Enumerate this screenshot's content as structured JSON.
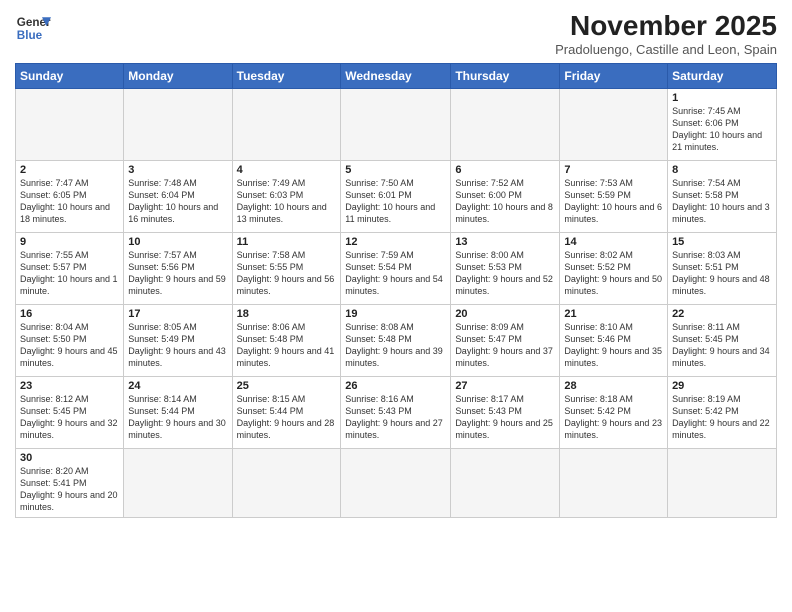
{
  "header": {
    "logo_line1": "General",
    "logo_line2": "Blue",
    "month": "November 2025",
    "location": "Pradoluengo, Castille and Leon, Spain"
  },
  "weekdays": [
    "Sunday",
    "Monday",
    "Tuesday",
    "Wednesday",
    "Thursday",
    "Friday",
    "Saturday"
  ],
  "weeks": [
    [
      {
        "day": "",
        "info": ""
      },
      {
        "day": "",
        "info": ""
      },
      {
        "day": "",
        "info": ""
      },
      {
        "day": "",
        "info": ""
      },
      {
        "day": "",
        "info": ""
      },
      {
        "day": "",
        "info": ""
      },
      {
        "day": "1",
        "info": "Sunrise: 7:45 AM\nSunset: 6:06 PM\nDaylight: 10 hours and 21 minutes."
      }
    ],
    [
      {
        "day": "2",
        "info": "Sunrise: 7:47 AM\nSunset: 6:05 PM\nDaylight: 10 hours and 18 minutes."
      },
      {
        "day": "3",
        "info": "Sunrise: 7:48 AM\nSunset: 6:04 PM\nDaylight: 10 hours and 16 minutes."
      },
      {
        "day": "4",
        "info": "Sunrise: 7:49 AM\nSunset: 6:03 PM\nDaylight: 10 hours and 13 minutes."
      },
      {
        "day": "5",
        "info": "Sunrise: 7:50 AM\nSunset: 6:01 PM\nDaylight: 10 hours and 11 minutes."
      },
      {
        "day": "6",
        "info": "Sunrise: 7:52 AM\nSunset: 6:00 PM\nDaylight: 10 hours and 8 minutes."
      },
      {
        "day": "7",
        "info": "Sunrise: 7:53 AM\nSunset: 5:59 PM\nDaylight: 10 hours and 6 minutes."
      },
      {
        "day": "8",
        "info": "Sunrise: 7:54 AM\nSunset: 5:58 PM\nDaylight: 10 hours and 3 minutes."
      }
    ],
    [
      {
        "day": "9",
        "info": "Sunrise: 7:55 AM\nSunset: 5:57 PM\nDaylight: 10 hours and 1 minute."
      },
      {
        "day": "10",
        "info": "Sunrise: 7:57 AM\nSunset: 5:56 PM\nDaylight: 9 hours and 59 minutes."
      },
      {
        "day": "11",
        "info": "Sunrise: 7:58 AM\nSunset: 5:55 PM\nDaylight: 9 hours and 56 minutes."
      },
      {
        "day": "12",
        "info": "Sunrise: 7:59 AM\nSunset: 5:54 PM\nDaylight: 9 hours and 54 minutes."
      },
      {
        "day": "13",
        "info": "Sunrise: 8:00 AM\nSunset: 5:53 PM\nDaylight: 9 hours and 52 minutes."
      },
      {
        "day": "14",
        "info": "Sunrise: 8:02 AM\nSunset: 5:52 PM\nDaylight: 9 hours and 50 minutes."
      },
      {
        "day": "15",
        "info": "Sunrise: 8:03 AM\nSunset: 5:51 PM\nDaylight: 9 hours and 48 minutes."
      }
    ],
    [
      {
        "day": "16",
        "info": "Sunrise: 8:04 AM\nSunset: 5:50 PM\nDaylight: 9 hours and 45 minutes."
      },
      {
        "day": "17",
        "info": "Sunrise: 8:05 AM\nSunset: 5:49 PM\nDaylight: 9 hours and 43 minutes."
      },
      {
        "day": "18",
        "info": "Sunrise: 8:06 AM\nSunset: 5:48 PM\nDaylight: 9 hours and 41 minutes."
      },
      {
        "day": "19",
        "info": "Sunrise: 8:08 AM\nSunset: 5:48 PM\nDaylight: 9 hours and 39 minutes."
      },
      {
        "day": "20",
        "info": "Sunrise: 8:09 AM\nSunset: 5:47 PM\nDaylight: 9 hours and 37 minutes."
      },
      {
        "day": "21",
        "info": "Sunrise: 8:10 AM\nSunset: 5:46 PM\nDaylight: 9 hours and 35 minutes."
      },
      {
        "day": "22",
        "info": "Sunrise: 8:11 AM\nSunset: 5:45 PM\nDaylight: 9 hours and 34 minutes."
      }
    ],
    [
      {
        "day": "23",
        "info": "Sunrise: 8:12 AM\nSunset: 5:45 PM\nDaylight: 9 hours and 32 minutes."
      },
      {
        "day": "24",
        "info": "Sunrise: 8:14 AM\nSunset: 5:44 PM\nDaylight: 9 hours and 30 minutes."
      },
      {
        "day": "25",
        "info": "Sunrise: 8:15 AM\nSunset: 5:44 PM\nDaylight: 9 hours and 28 minutes."
      },
      {
        "day": "26",
        "info": "Sunrise: 8:16 AM\nSunset: 5:43 PM\nDaylight: 9 hours and 27 minutes."
      },
      {
        "day": "27",
        "info": "Sunrise: 8:17 AM\nSunset: 5:43 PM\nDaylight: 9 hours and 25 minutes."
      },
      {
        "day": "28",
        "info": "Sunrise: 8:18 AM\nSunset: 5:42 PM\nDaylight: 9 hours and 23 minutes."
      },
      {
        "day": "29",
        "info": "Sunrise: 8:19 AM\nSunset: 5:42 PM\nDaylight: 9 hours and 22 minutes."
      }
    ],
    [
      {
        "day": "30",
        "info": "Sunrise: 8:20 AM\nSunset: 5:41 PM\nDaylight: 9 hours and 20 minutes."
      },
      {
        "day": "",
        "info": ""
      },
      {
        "day": "",
        "info": ""
      },
      {
        "day": "",
        "info": ""
      },
      {
        "day": "",
        "info": ""
      },
      {
        "day": "",
        "info": ""
      },
      {
        "day": "",
        "info": ""
      }
    ]
  ]
}
